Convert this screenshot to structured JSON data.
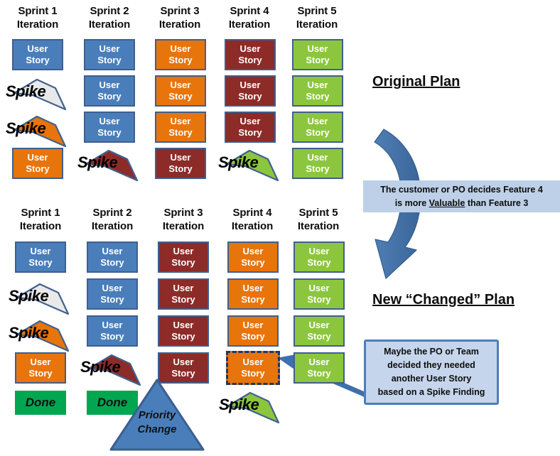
{
  "diagram": {
    "title_original": "Original Plan",
    "title_new": "New “Changed” Plan",
    "card_label_line1": "User",
    "card_label_line2": "Story",
    "spike_label": "Spike",
    "done_label": "Done",
    "priority_line1": "Priority",
    "priority_line2": "Change"
  },
  "colors": {
    "blue": "#4a7ebb",
    "orange": "#e8740c",
    "red": "#8c2b28",
    "green": "#8cc63e",
    "done_green": "#00a650",
    "card_border": "#3f5f8f",
    "dashed_border": "#1f3864",
    "callout_flat_bg": "#bdd0e8",
    "callout_box_bg": "#c5d5ec",
    "arrow_blue": "#3f6fac",
    "text": "#0d0d0d"
  },
  "top_plan": {
    "heading_line1": "Sprint",
    "columns": [
      {
        "name": "Sprint 1",
        "sub": "Iteration",
        "items": [
          {
            "type": "card",
            "color": "blue"
          },
          {
            "type": "spike",
            "color": "white"
          },
          {
            "type": "spike",
            "color": "orange"
          },
          {
            "type": "card",
            "color": "orange"
          }
        ]
      },
      {
        "name": "Sprint 2",
        "sub": "Iteration",
        "items": [
          {
            "type": "card",
            "color": "blue"
          },
          {
            "type": "card",
            "color": "blue"
          },
          {
            "type": "card",
            "color": "blue"
          },
          {
            "type": "spike",
            "color": "red"
          }
        ]
      },
      {
        "name": "Sprint 3",
        "sub": "Iteration",
        "items": [
          {
            "type": "card",
            "color": "orange"
          },
          {
            "type": "card",
            "color": "orange"
          },
          {
            "type": "card",
            "color": "orange"
          },
          {
            "type": "card",
            "color": "red"
          }
        ]
      },
      {
        "name": "Sprint 4",
        "sub": "Iteration",
        "items": [
          {
            "type": "card",
            "color": "red"
          },
          {
            "type": "card",
            "color": "red"
          },
          {
            "type": "card",
            "color": "red"
          },
          {
            "type": "spike",
            "color": "green"
          }
        ]
      },
      {
        "name": "Sprint 5",
        "sub": "Iteration",
        "items": [
          {
            "type": "card",
            "color": "green"
          },
          {
            "type": "card",
            "color": "green"
          },
          {
            "type": "card",
            "color": "green"
          },
          {
            "type": "card",
            "color": "green"
          }
        ]
      }
    ]
  },
  "bottom_plan": {
    "columns": [
      {
        "name": "Sprint 1",
        "sub": "Iteration",
        "items": [
          {
            "type": "card",
            "color": "blue"
          },
          {
            "type": "spike",
            "color": "white"
          },
          {
            "type": "spike",
            "color": "orange"
          },
          {
            "type": "card",
            "color": "orange"
          },
          {
            "type": "done"
          }
        ]
      },
      {
        "name": "Sprint 2",
        "sub": "Iteration",
        "items": [
          {
            "type": "card",
            "color": "blue"
          },
          {
            "type": "card",
            "color": "blue"
          },
          {
            "type": "card",
            "color": "blue"
          },
          {
            "type": "spike",
            "color": "red"
          },
          {
            "type": "done"
          }
        ]
      },
      {
        "name": "Sprint 3",
        "sub": "Iteration",
        "items": [
          {
            "type": "card",
            "color": "red"
          },
          {
            "type": "card",
            "color": "red"
          },
          {
            "type": "card",
            "color": "red"
          },
          {
            "type": "card",
            "color": "red"
          }
        ]
      },
      {
        "name": "Sprint 4",
        "sub": "Iteration",
        "items": [
          {
            "type": "card",
            "color": "orange"
          },
          {
            "type": "card",
            "color": "orange"
          },
          {
            "type": "card",
            "color": "orange"
          },
          {
            "type": "card",
            "color": "orange",
            "highlighted": true
          },
          {
            "type": "spike",
            "color": "green"
          }
        ]
      },
      {
        "name": "Sprint 5",
        "sub": "Iteration",
        "items": [
          {
            "type": "card",
            "color": "green"
          },
          {
            "type": "card",
            "color": "green"
          },
          {
            "type": "card",
            "color": "green"
          },
          {
            "type": "card",
            "color": "green"
          }
        ]
      }
    ],
    "priority_change": {
      "line1": "Priority",
      "line2": "Change"
    }
  },
  "callouts": {
    "value_change": {
      "line1": "The customer or PO decides Feature 4",
      "line2_pre": "is more ",
      "line2_underline": "Valuable",
      "line2_post": " than Feature 3"
    },
    "extra_story": {
      "line1": "Maybe the PO or Team",
      "line2": "decided they needed",
      "line3": "another User Story",
      "line4": "based on a Spike Finding"
    }
  }
}
